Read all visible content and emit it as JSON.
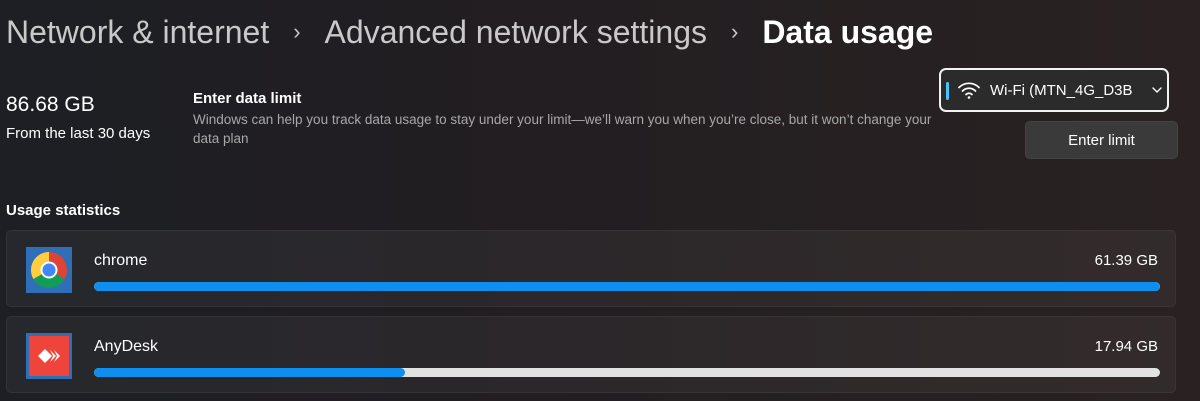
{
  "breadcrumb": {
    "items": [
      "Network & internet",
      "Advanced network settings",
      "Data usage"
    ],
    "separator": "›"
  },
  "summary": {
    "total": "86.68 GB",
    "period": "From the last 30 days"
  },
  "data_limit": {
    "title": "Enter data limit",
    "description": "Windows can help you track data usage to stay under your limit—we’ll warn you when you’re close, but it won’t change your data plan",
    "button_label": "Enter limit"
  },
  "network_select": {
    "icon": "wifi-icon",
    "selected": "Wi-Fi (MTN_4G_D3B"
  },
  "usage": {
    "title": "Usage statistics",
    "apps": [
      {
        "name": "chrome",
        "usage": "61.39 GB",
        "fraction": 1.0,
        "icon": "chrome-icon"
      },
      {
        "name": "AnyDesk",
        "usage": "17.94 GB",
        "fraction": 0.292,
        "icon": "anydesk-icon"
      }
    ]
  },
  "colors": {
    "accent": "#0e8ff0",
    "track": "#e2e2e2",
    "focus": "#4cc2ff"
  }
}
